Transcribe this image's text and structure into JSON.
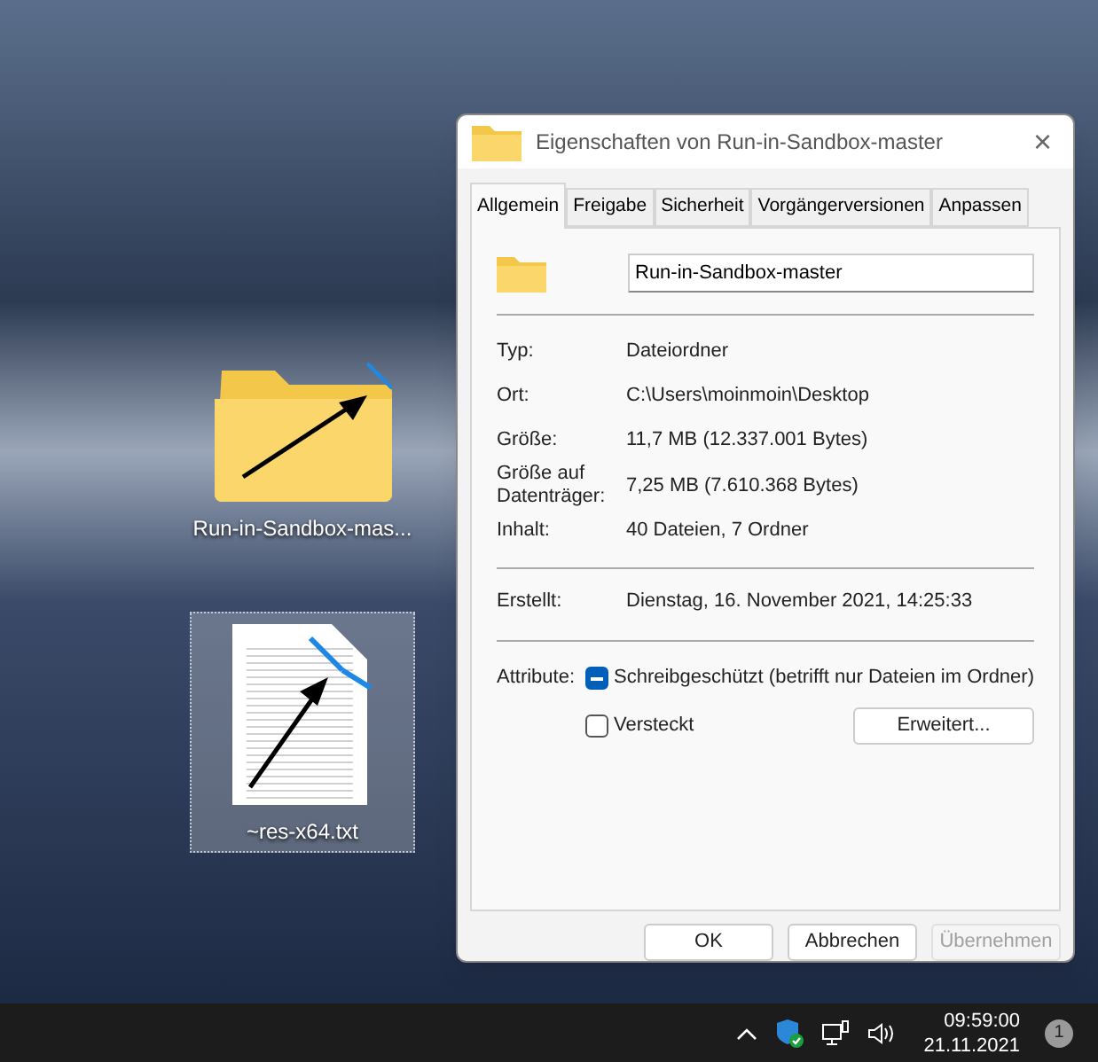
{
  "desktop_icons": [
    {
      "kind": "folder",
      "label": "Run-in-Sandbox-mas...",
      "selected": false
    },
    {
      "kind": "textfile",
      "label": "~res-x64.txt",
      "selected": true
    }
  ],
  "window": {
    "title": "Eigenschaften von Run-in-Sandbox-master",
    "close": "×"
  },
  "tabs": [
    {
      "label": "Allgemein",
      "selected": true
    },
    {
      "label": "Freigabe",
      "selected": false
    },
    {
      "label": "Sicherheit",
      "selected": false
    },
    {
      "label": "Vorgängerversionen",
      "selected": false
    },
    {
      "label": "Anpassen",
      "selected": false
    }
  ],
  "name_field": {
    "value": "Run-in-Sandbox-master"
  },
  "properties": [
    {
      "label": "Typ:",
      "value": "Dateiordner"
    },
    {
      "label": "Ort:",
      "value": "C:\\Users\\moinmoin\\Desktop"
    },
    {
      "label": "Größe:",
      "value": "11,7 MB (12.337.001 Bytes)"
    },
    {
      "label": "Größe auf Datenträger:",
      "value": "7,25 MB (7.610.368 Bytes)"
    },
    {
      "label": "Inhalt:",
      "value": "40 Dateien, 7 Ordner"
    }
  ],
  "created": {
    "label": "Erstellt:",
    "value": "Dienstag, 16. November 2021, 14:25:33"
  },
  "attributes": {
    "label": "Attribute:",
    "items": [
      {
        "label": "Schreibgeschützt (betrifft nur Dateien im Ordner)",
        "checked": true,
        "mixed": true
      },
      {
        "label": "Versteckt",
        "checked": false,
        "mixed": false
      }
    ],
    "advanced_button": "Erweitert..."
  },
  "buttons": [
    {
      "label": "OK",
      "disabled": false
    },
    {
      "label": "Abbrechen",
      "disabled": false
    },
    {
      "label": "Übernehmen",
      "disabled": true
    }
  ],
  "taskbar": {
    "time": "09:59:00",
    "date": "21.11.2021",
    "notifications": "1"
  }
}
